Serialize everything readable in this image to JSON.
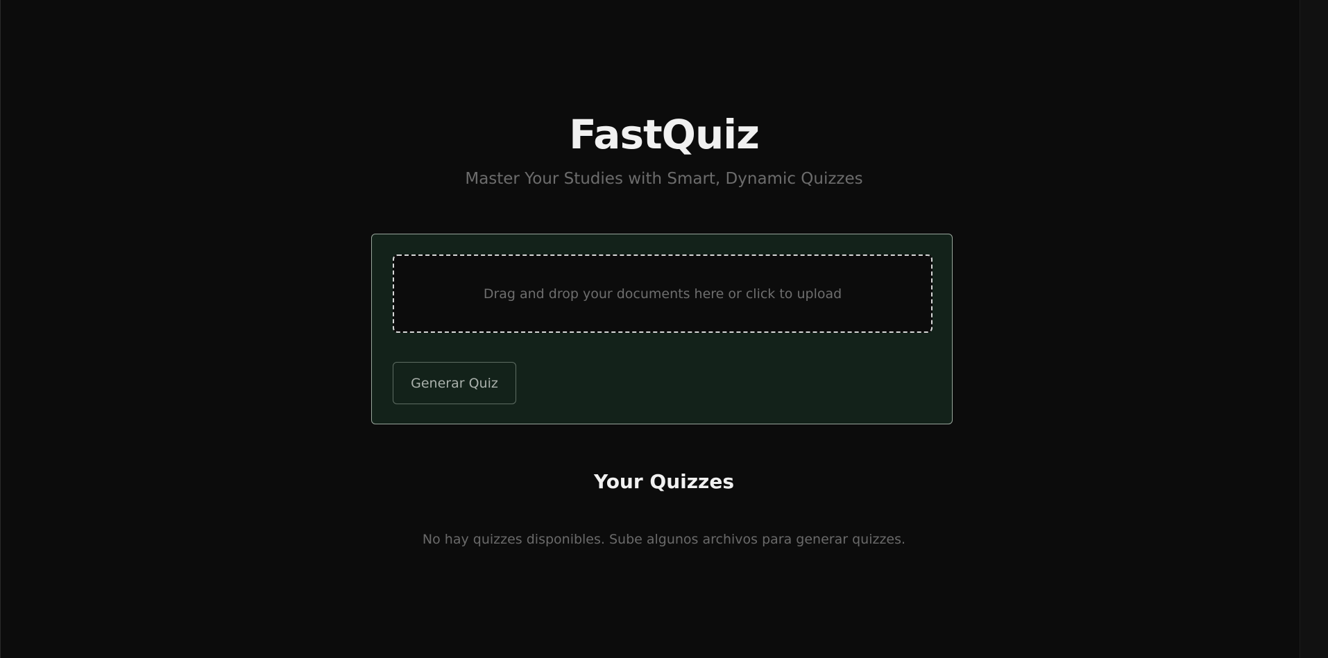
{
  "header": {
    "title": "FastQuiz",
    "subtitle": "Master Your Studies with Smart, Dynamic Quizzes"
  },
  "upload": {
    "dropzone_text": "Drag and drop your documents here or click to upload",
    "generate_label": "Generar Quiz"
  },
  "quizzes": {
    "section_title": "Your Quizzes",
    "empty_message": "No hay quizzes disponibles. Sube algunos archivos para generar quizzes."
  },
  "colors": {
    "background": "#0c0c0c",
    "card_background": "#13221a",
    "card_border": "#9aa79d",
    "title_text": "#f1f1f1",
    "muted_text": "#6c6c6c"
  }
}
